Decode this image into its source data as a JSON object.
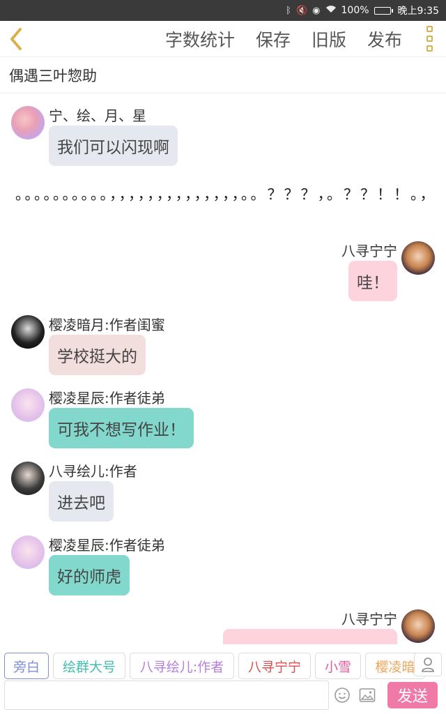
{
  "status_bar": {
    "icons": [
      "bluetooth-icon",
      "mute-icon",
      "eye-icon",
      "wifi-icon"
    ],
    "battery_text": "100%",
    "battery_level": 1.0,
    "time": "晚上9:35"
  },
  "app_bar": {
    "actions": [
      "字数统计",
      "保存",
      "旧版",
      "发布"
    ]
  },
  "story_title": "偶遇三叶惣助",
  "messages": [
    {
      "name": "宁、绘、月、星",
      "text": "我们可以闪现啊",
      "side": "left",
      "bubble_color": "#e5e9ef"
    },
    {
      "name": "八寻宁宁",
      "text": "哇！",
      "side": "right",
      "bubble_color": "#fdd3de"
    },
    {
      "name": "樱凌暗月:作者闺蜜",
      "text": "学校挺大的",
      "side": "left",
      "bubble_color": "#f3dede"
    },
    {
      "name": "樱凌星辰:作者徒弟",
      "text": "可我不想写作业！",
      "side": "left",
      "bubble_color": "#82d8cc"
    },
    {
      "name": "八寻绘儿:作者",
      "text": "进去吧",
      "side": "left",
      "bubble_color": "#e5e9ef"
    },
    {
      "name": "樱凌星辰:作者徒弟",
      "text": "好的师虎",
      "side": "left",
      "bubble_color": "#82d8cc"
    },
    {
      "name": "八寻宁宁",
      "text": "",
      "side": "right",
      "bubble_color": "#fdd3de"
    }
  ],
  "narration": "。。。。。。。。。。，，，，，，，，，，，，，，。。？？？，。？？！！。，",
  "speakers": [
    {
      "label": "旁白",
      "color": "#7d8fd6",
      "active": true
    },
    {
      "label": "绘群大号",
      "color": "#3fbfae",
      "active": false
    },
    {
      "label": "八寻绘儿:作者",
      "color": "#b57edc",
      "active": false
    },
    {
      "label": "八寻宁宁",
      "color": "#e14c4c",
      "active": false
    },
    {
      "label": "小雪",
      "color": "#e85a9a",
      "active": false
    },
    {
      "label": "樱凌暗",
      "color": "#f0a55a",
      "active": false
    }
  ],
  "input": {
    "placeholder": ""
  },
  "send_label": "发送",
  "colors": {
    "accent": "#f07aa7",
    "back_arrow": "#d8b14a"
  }
}
